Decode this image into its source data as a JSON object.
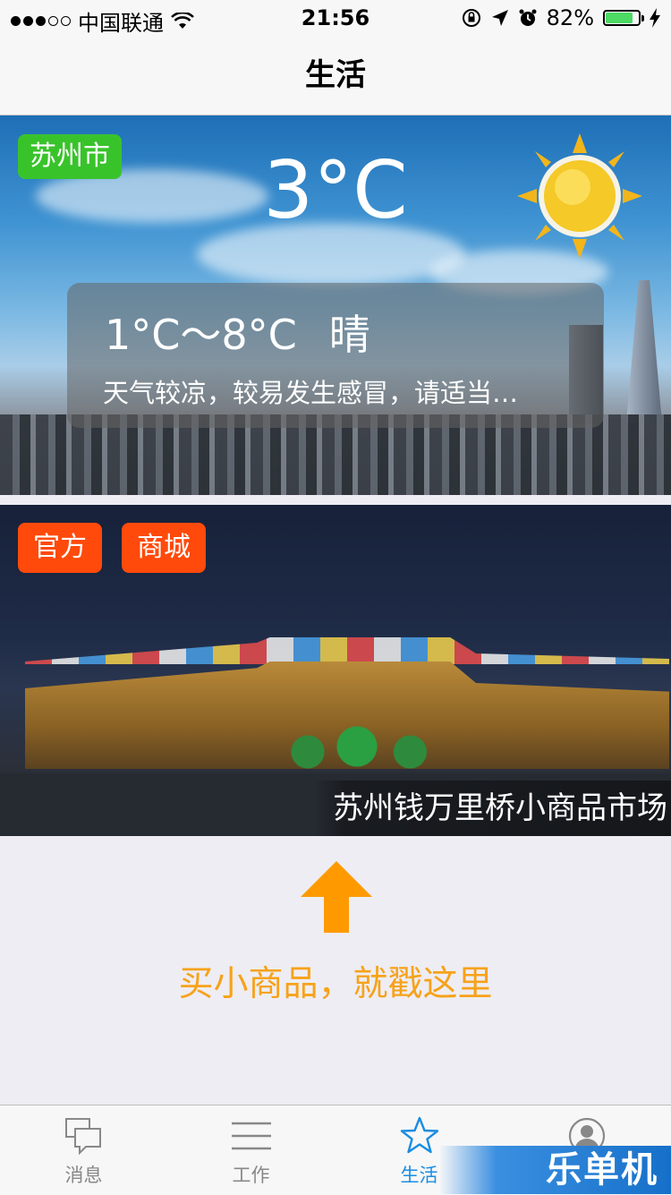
{
  "status_bar": {
    "carrier": "中国联通",
    "time": "21:56",
    "battery_percent": "82%",
    "battery_level": 0.82,
    "signal_bars_filled": 3,
    "signal_bars_total": 5
  },
  "nav": {
    "title": "生活"
  },
  "weather": {
    "city": "苏州市",
    "current_temp": "3°C",
    "temp_range": "1°C～8°C",
    "condition": "晴",
    "advice": "天气较凉，较易发生感冒，请适当…",
    "sun_icon": "sun-icon"
  },
  "mall": {
    "tags": [
      "官方",
      "商城"
    ],
    "caption": "苏州钱万里桥小商品市场"
  },
  "promo": {
    "arrow_icon": "up-arrow-icon",
    "text": "买小商品，就戳这里",
    "color": "#f7a21a"
  },
  "tab_bar": {
    "items": [
      {
        "label": "消息",
        "icon": "message-icon",
        "active": false
      },
      {
        "label": "工作",
        "icon": "menu-lines-icon",
        "active": false
      },
      {
        "label": "生活",
        "icon": "star-icon",
        "active": true
      },
      {
        "label": "",
        "icon": "user-avatar-icon",
        "active": false
      }
    ],
    "active_color": "#1b8de0",
    "inactive_color": "#888888"
  },
  "watermark": {
    "text": "乐单机"
  },
  "colors": {
    "city_badge": "#39c32b",
    "tag": "#ff4a0b",
    "background": "#eeedf3"
  }
}
